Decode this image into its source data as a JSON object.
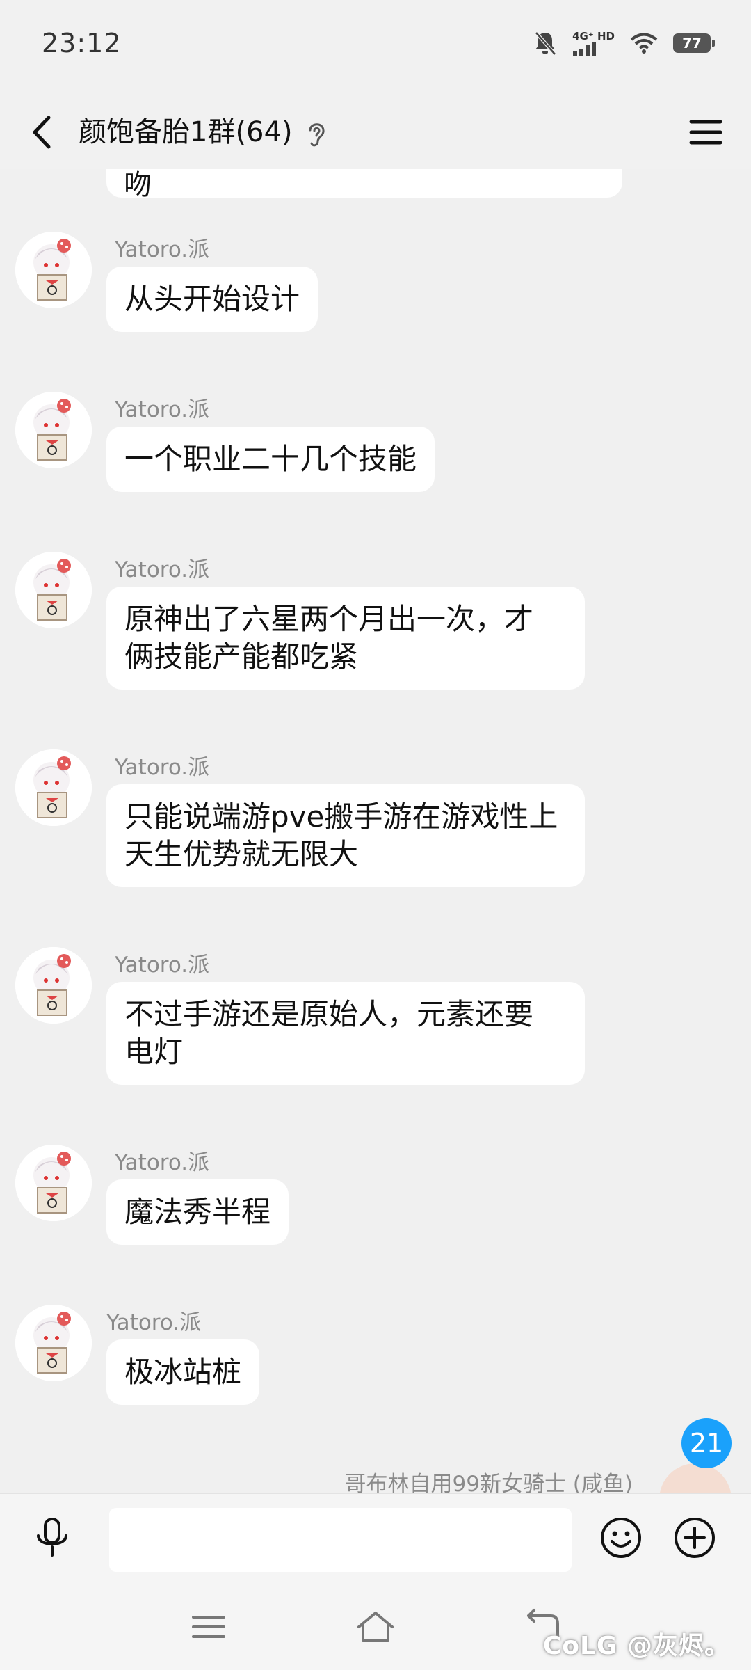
{
  "status_bar": {
    "time": "23:12",
    "network": "4G⁺ HD",
    "battery": "77",
    "icons": [
      "bell-off-icon",
      "signal-icon",
      "wifi-icon",
      "battery-icon"
    ]
  },
  "header": {
    "title": "颜饱备胎1群(64)",
    "icons": [
      "back-arrow-icon",
      "ear-icon",
      "hamburger-menu-icon"
    ]
  },
  "chat": {
    "prev_fragment": "吻",
    "messages": [
      {
        "sender": "Yatoro.派",
        "lines": [
          "从头开始设计"
        ]
      },
      {
        "sender": "Yatoro.派",
        "lines": [
          "一个职业二十几个技能"
        ]
      },
      {
        "sender": "Yatoro.派",
        "lines": [
          "原神出了六星两个月出一次，才",
          "俩技能产能都吃紧"
        ]
      },
      {
        "sender": "Yatoro.派",
        "lines": [
          "只能说端游pve搬手游在游戏性上",
          "天生优势就无限大"
        ]
      },
      {
        "sender": "Yatoro.派",
        "lines": [
          "不过手游还是原始人，元素还要",
          "电灯"
        ]
      },
      {
        "sender": "Yatoro.派",
        "lines": [
          "魔法秀半程"
        ]
      },
      {
        "sender": "Yatoro.派",
        "lines": [
          "极冰站桩"
        ]
      }
    ],
    "bottom_sender": "哥布林自用99新女骑士 (咸鱼)",
    "unread_count": "21"
  },
  "input_bar": {
    "placeholder": "",
    "icons": [
      "microphone-icon",
      "emoji-icon",
      "plus-circle-icon"
    ]
  },
  "nav_bar": {
    "icons": [
      "recent-apps-icon",
      "home-icon",
      "back-nav-icon"
    ],
    "watermark": "CoLG @灰烬。"
  },
  "colors": {
    "background": "#f1f1f1",
    "bubble": "#ffffff",
    "badge": "#1aa1fb",
    "sender_text": "#8a8a8a"
  }
}
